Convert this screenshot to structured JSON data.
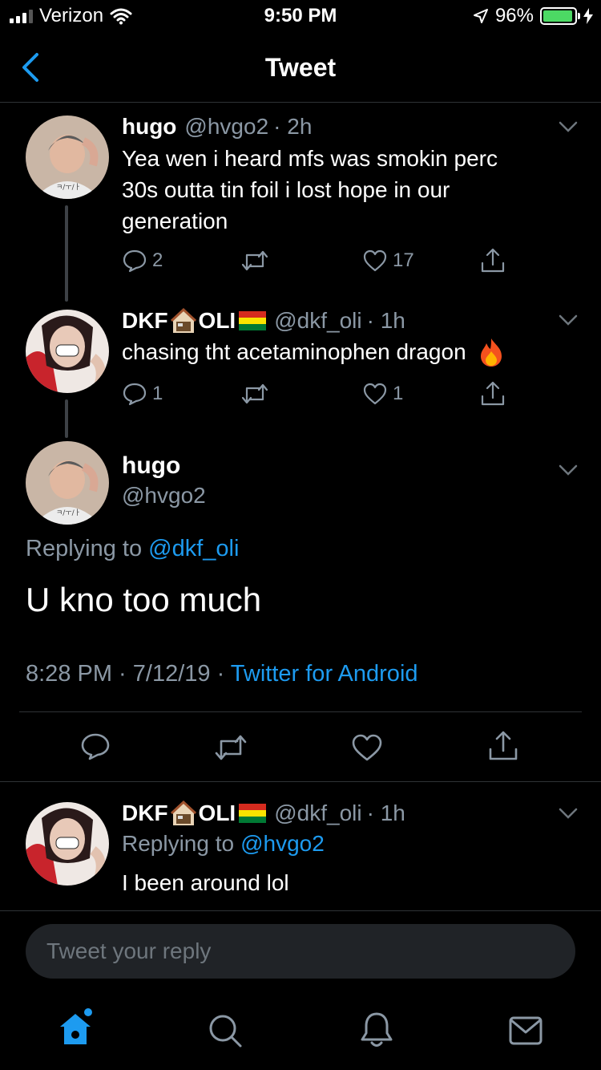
{
  "status_bar": {
    "carrier": "Verizon",
    "time": "9:50 PM",
    "battery_percent": "96%",
    "battery_level": 0.96
  },
  "header": {
    "title": "Tweet"
  },
  "thread": [
    {
      "name": "hugo",
      "handle": "@hvgo2",
      "time": "· 2h",
      "lines": [
        "Yea wen i heard mfs was smokin perc",
        "30s outta tin foil i lost hope in our",
        "generation"
      ],
      "replies": "2",
      "retweets": "",
      "likes": "17"
    },
    {
      "name_a": "DKF",
      "name_b": "OLI",
      "handle": "@dkf_oli",
      "time": "· 1h",
      "text": "chasing tht acetaminophen dragon",
      "replies": "1",
      "retweets": "",
      "likes": "1"
    }
  ],
  "main_tweet": {
    "name": "hugo",
    "handle": "@hvgo2",
    "replying_prefix": "Replying to",
    "replying_handle": "@dkf_oli",
    "text": "U kno too much",
    "timestamp": "8:28 PM · 7/12/19 ·",
    "source": "Twitter for Android"
  },
  "reply_tweet": {
    "name_a": "DKF",
    "name_b": "OLI",
    "handle": "@dkf_oli",
    "time": "· 1h",
    "replying_prefix": "Replying to",
    "replying_handle": "@hvgo2",
    "text": "I been around lol"
  },
  "reply_input": {
    "placeholder": "Tweet your reply"
  },
  "colors": {
    "accent": "#1d9bf0",
    "background": "#000000",
    "muted": "#8b98a5",
    "battery": "#4cd964"
  },
  "icons": [
    "back-chevron-icon",
    "reply-icon",
    "retweet-icon",
    "like-icon",
    "share-icon",
    "home-icon",
    "search-icon",
    "notifications-icon",
    "messages-icon"
  ]
}
